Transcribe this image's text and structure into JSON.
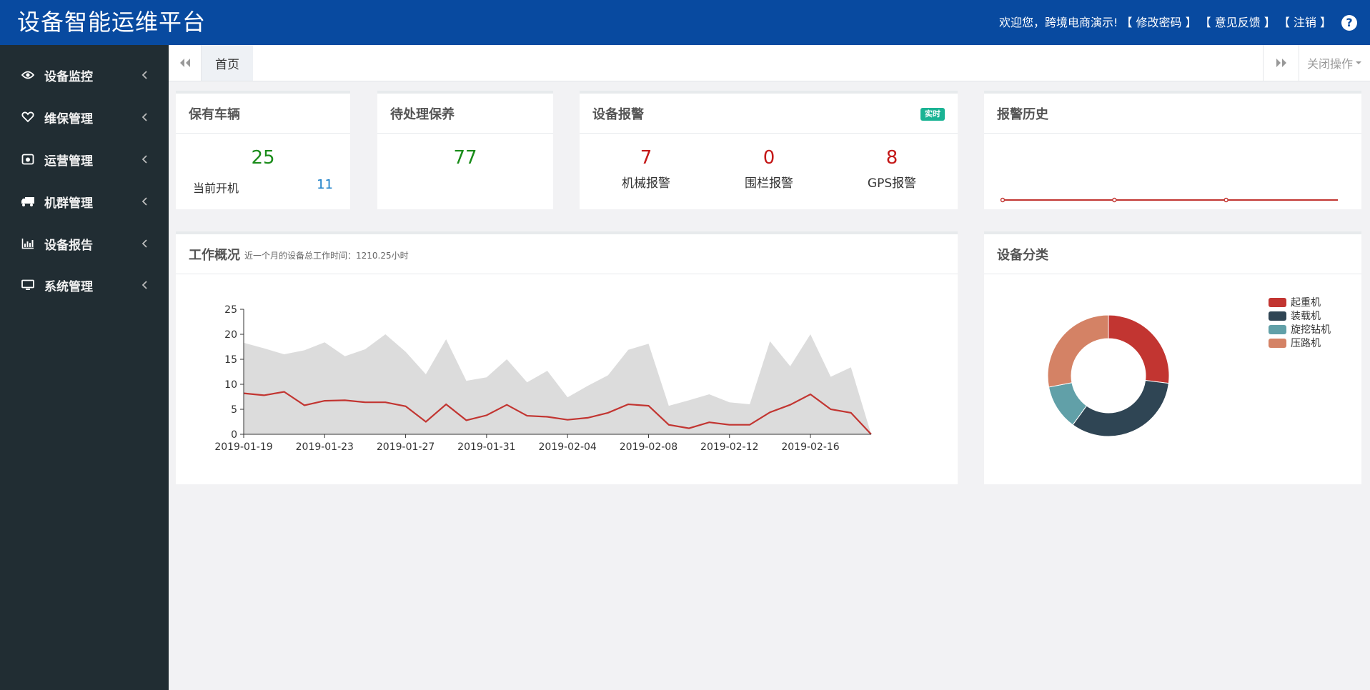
{
  "header": {
    "title": "设备智能运维平台",
    "welcome": "欢迎您，跨境电商演示!",
    "change_password": "【 修改密码 】",
    "feedback": "【 意见反馈 】",
    "logout": "【 注销 】",
    "help_icon": "?"
  },
  "sidebar": {
    "items": [
      {
        "label": "设备监控",
        "icon": "eye-icon"
      },
      {
        "label": "维保管理",
        "icon": "heart-icon"
      },
      {
        "label": "运营管理",
        "icon": "camera-icon"
      },
      {
        "label": "机群管理",
        "icon": "truck-icon"
      },
      {
        "label": "设备报告",
        "icon": "bar-chart-icon"
      },
      {
        "label": "系统管理",
        "icon": "monitor-icon"
      }
    ]
  },
  "tabs": {
    "home": "首页",
    "close_ops": "关闭操作"
  },
  "cards": {
    "vehicles": {
      "title": "保有车辆",
      "total": "25",
      "running_label": "当前开机",
      "running": "11"
    },
    "maintenance": {
      "title": "待处理保养",
      "count": "77"
    },
    "alarms": {
      "title": "设备报警",
      "badge": "实时",
      "items": [
        {
          "value": "7",
          "label": "机械报警"
        },
        {
          "value": "0",
          "label": "围栏报警"
        },
        {
          "value": "8",
          "label": "GPS报警"
        }
      ]
    },
    "alarm_history": {
      "title": "报警历史"
    },
    "work": {
      "title": "工作概况",
      "subtitle": "近一个月的设备总工作时间：1210.25小时"
    },
    "category": {
      "title": "设备分类"
    }
  },
  "colors": {
    "header": "#084aa0",
    "sidebar": "#212d33",
    "line_red": "#c23531",
    "area_grey": "#dcdcdc"
  },
  "chart_data": [
    {
      "type": "area",
      "title": "工作概况",
      "x": [
        "2019-01-19",
        "2019-01-20",
        "2019-01-21",
        "2019-01-22",
        "2019-01-23",
        "2019-01-24",
        "2019-01-25",
        "2019-01-26",
        "2019-01-27",
        "2019-01-28",
        "2019-01-29",
        "2019-01-30",
        "2019-01-31",
        "2019-02-01",
        "2019-02-02",
        "2019-02-03",
        "2019-02-04",
        "2019-02-05",
        "2019-02-06",
        "2019-02-07",
        "2019-02-08",
        "2019-02-09",
        "2019-02-10",
        "2019-02-11",
        "2019-02-12",
        "2019-02-13",
        "2019-02-14",
        "2019-02-15",
        "2019-02-16",
        "2019-02-17",
        "2019-02-18",
        "2019-02-19"
      ],
      "x_ticks": [
        "2019-01-19",
        "2019-01-23",
        "2019-01-27",
        "2019-01-31",
        "2019-02-04",
        "2019-02-08",
        "2019-02-12",
        "2019-02-16"
      ],
      "series": [
        {
          "values": [
            18.3,
            17.2,
            16.0,
            16.8,
            18.4,
            15.6,
            17.0,
            20.0,
            16.5,
            12.0,
            19.0,
            10.7,
            11.4,
            15.0,
            10.4,
            12.7,
            7.4,
            9.7,
            11.8,
            16.9,
            18.1,
            5.7,
            6.8,
            8.0,
            6.4,
            6.0,
            18.6,
            13.6,
            20.0,
            11.5,
            13.4,
            0
          ]
        },
        {
          "values": [
            8.2,
            7.8,
            8.5,
            5.8,
            6.7,
            6.8,
            6.4,
            6.4,
            5.6,
            2.5,
            6.0,
            2.8,
            3.8,
            5.9,
            3.7,
            3.5,
            2.9,
            3.3,
            4.3,
            6.0,
            5.7,
            1.9,
            1.2,
            2.4,
            1.9,
            1.9,
            4.4,
            5.9,
            8.0,
            5.0,
            4.3,
            0
          ]
        }
      ],
      "ylim": [
        0,
        25
      ],
      "y_ticks": [
        0,
        5,
        10,
        15,
        20,
        25
      ],
      "grid": false
    },
    {
      "type": "pie",
      "title": "设备分类",
      "categories": [
        "起重机",
        "装载机",
        "旋挖钻机",
        "压路机"
      ],
      "values": [
        27,
        33,
        12,
        28
      ],
      "colors": [
        "#c23531",
        "#2f4554",
        "#61a0a8",
        "#d48265"
      ],
      "legend": "top-right"
    },
    {
      "type": "line",
      "title": "报警历史",
      "values": [
        0,
        0,
        0,
        0
      ],
      "grid": false
    }
  ]
}
